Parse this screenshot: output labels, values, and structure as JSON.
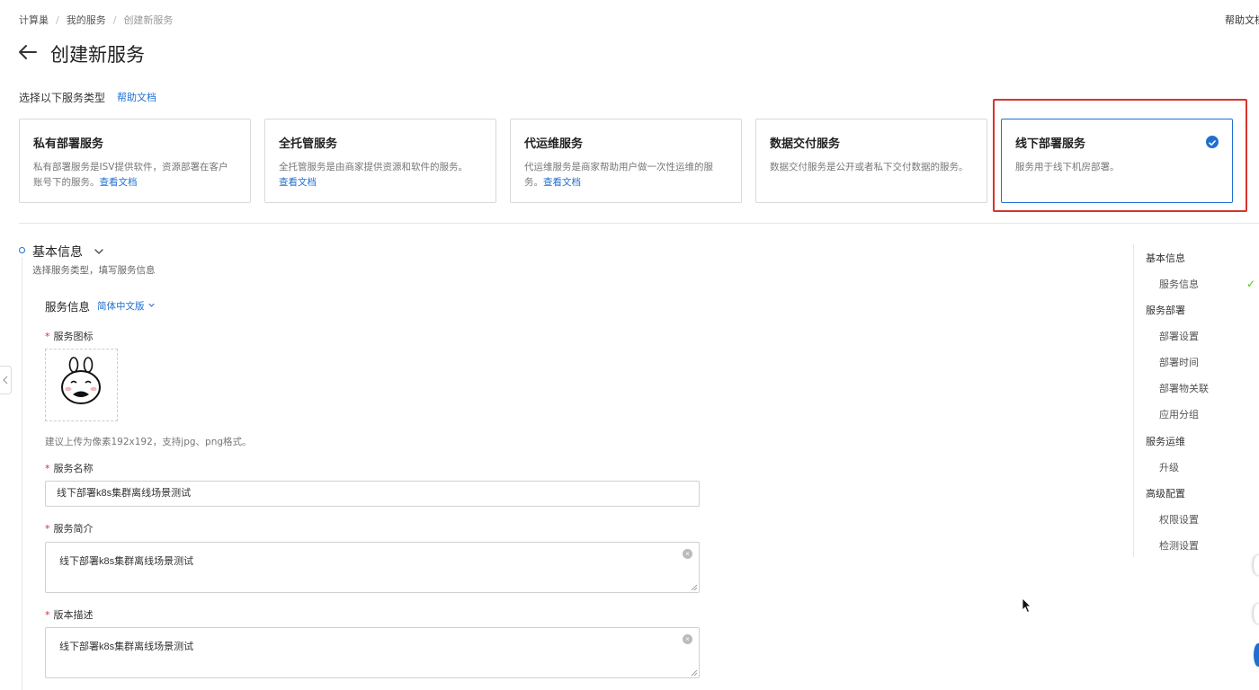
{
  "breadcrumb": {
    "items": [
      "计算巢",
      "我的服务"
    ],
    "current": "创建新服务",
    "separator": "/"
  },
  "header": {
    "help_link": "帮助文档",
    "title": "创建新服务"
  },
  "service_type": {
    "label": "选择以下服务类型",
    "help_link": "帮助文档",
    "cards": [
      {
        "title": "私有部署服务",
        "desc": "私有部署服务是ISV提供软件，资源部署在客户账号下的服务。",
        "link": "查看文档",
        "selected": false
      },
      {
        "title": "全托管服务",
        "desc": "全托管服务是由商家提供资源和软件的服务。",
        "link": "查看文档",
        "selected": false
      },
      {
        "title": "代运维服务",
        "desc": "代运维服务是商家帮助用户做一次性运维的服务。",
        "link": "查看文档",
        "selected": false
      },
      {
        "title": "数据交付服务",
        "desc": "数据交付服务是公开或者私下交付数据的服务。",
        "link": "",
        "selected": false
      },
      {
        "title": "线下部署服务",
        "desc": "服务用于线下机房部署。",
        "link": "",
        "selected": true
      }
    ]
  },
  "basic_info": {
    "title": "基本信息",
    "subtitle": "选择服务类型，填写服务信息",
    "service_info_title": "服务信息",
    "language": "简体中文版",
    "required_mark": "*",
    "icon_label": "服务图标",
    "icon_hint": "建议上传为像素192x192，支持jpg、png格式。",
    "name_label": "服务名称",
    "name_value": "线下部署k8s集群离线场景测试",
    "summary_label": "服务简介",
    "summary_value": "线下部署k8s集群离线场景测试",
    "version_label": "版本描述",
    "version_value": "线下部署k8s集群离线场景测试"
  },
  "right_nav": {
    "groups": [
      {
        "title": "基本信息",
        "items": [
          {
            "label": "服务信息",
            "done": true
          }
        ]
      },
      {
        "title": "服务部署",
        "items": [
          {
            "label": "部署设置"
          },
          {
            "label": "部署时间"
          },
          {
            "label": "部署物关联"
          },
          {
            "label": "应用分组"
          }
        ]
      },
      {
        "title": "服务运维",
        "items": [
          {
            "label": "升级"
          }
        ]
      },
      {
        "title": "高级配置",
        "items": [
          {
            "label": "权限设置"
          },
          {
            "label": "检测设置"
          }
        ]
      }
    ],
    "done_mark": "✓"
  },
  "colors": {
    "accent": "#1f6fd1",
    "highlight": "#d8332b",
    "required": "#d8332b",
    "success": "#52c41a"
  }
}
